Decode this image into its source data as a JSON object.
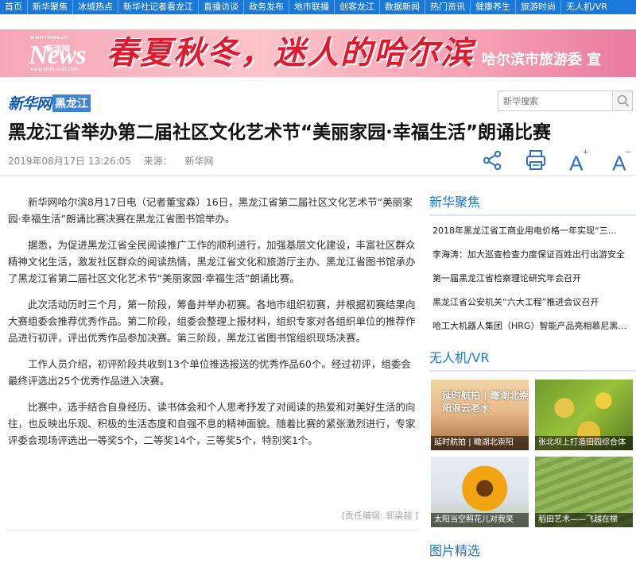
{
  "topnav": [
    "首页",
    "新华聚焦",
    "冰城热点",
    "新华社记者看龙江",
    "直播访谈",
    "政务发布",
    "地市联播",
    "创客龙江",
    "数据新闻",
    "热门资讯",
    "健康养生",
    "旅游时尚",
    "无人机/VR"
  ],
  "banner": {
    "logo_url": "www.news.cn",
    "logo_text": "News",
    "logo_cn": "新华网",
    "logo_url2": "www.xinhuanet.com",
    "slogan": "春夏秋冬，迷人的哈尔滨",
    "credit": "哈尔滨市旅游委 宣"
  },
  "site": {
    "logo_main": "新华网",
    "logo_region": "黑龙江"
  },
  "search": {
    "placeholder": "新华搜索"
  },
  "article": {
    "title": "黑龙江省举办第二届社区文化艺术节“美丽家园·幸福生活”朗诵比赛",
    "date": "2019年08月17日 13:26:05",
    "source_label": "来源：",
    "source": "新华网",
    "paragraphs": [
      "新华网哈尔滨8月17日电（记者董宝森）16日，黑龙江省第二届社区文化艺术节“美丽家园·幸福生活”朗诵比赛决赛在黑龙江省图书馆举办。",
      "据悉，为促进黑龙江省全民阅读推广工作的顺利进行，加强基层文化建设，丰富社区群众精神文化生活，激发社区群众的阅读热情，黑龙江省文化和旅游厅主办、黑龙江省图书馆承办了黑龙江省第二届社区文化艺术节“美丽家园·幸福生活”朗诵比赛。",
      "此次活动历时三个月，第一阶段，筹备并举办初赛。各地市组织初赛，并根据初赛结果向大赛组委会推荐优秀作品。第二阶段，组委会整理上报材料，组织专家对各组织单位的推荐作品进行初评，评出优秀作品参加决赛。第三阶段，黑龙江省图书馆组织现场决赛。",
      "工作人员介绍，初评阶段共收到13个单位推选报送的优秀作品60个。经过初评，组委会最终评选出25个优秀作品进入决赛。",
      "比赛中，选手结合自身经历、读书体会和个人思考抒发了对阅读的热爱和对美好生活的向往，也反映出乐观、积极的生活态度和自强不息的精神面貌。随着比赛的紧张激烈进行，专家评委会现场评选出一等奖5个，二等奖14个，三等奖5个，特别奖1个。"
    ],
    "editor": "[责任编辑: 郭梁越 ]"
  },
  "tools": {
    "font_up": "A",
    "font_down": "A",
    "plus": "+",
    "minus": "−"
  },
  "sidebar": {
    "focus_title": "新华聚焦",
    "focus_items": [
      "2018年黑龙江省工商业用电价格一年实现“三…",
      "李海涛：加大巡查检查力度保证百姓出行出游安全",
      "第一届黑龙江省检察理论研究年会召开",
      "黑龙江省公安机关“六大工程”推进会议召开",
      "哈工大机器人集团（HRG）智能产品亮相慕尼黑…"
    ],
    "vr_title": "无人机/VR",
    "vr_items": [
      {
        "caption": "延时航拍 | 瞰湖北崇阳",
        "art": "延时航拍 | 瞰湖北崇阳浪云老水"
      },
      {
        "caption": "张北坝上打造田园综合体"
      },
      {
        "caption": "太阳当空照花儿对我笑"
      },
      {
        "caption": "稻田艺术——飞越在梯"
      }
    ],
    "photo_title": "图片精选"
  }
}
